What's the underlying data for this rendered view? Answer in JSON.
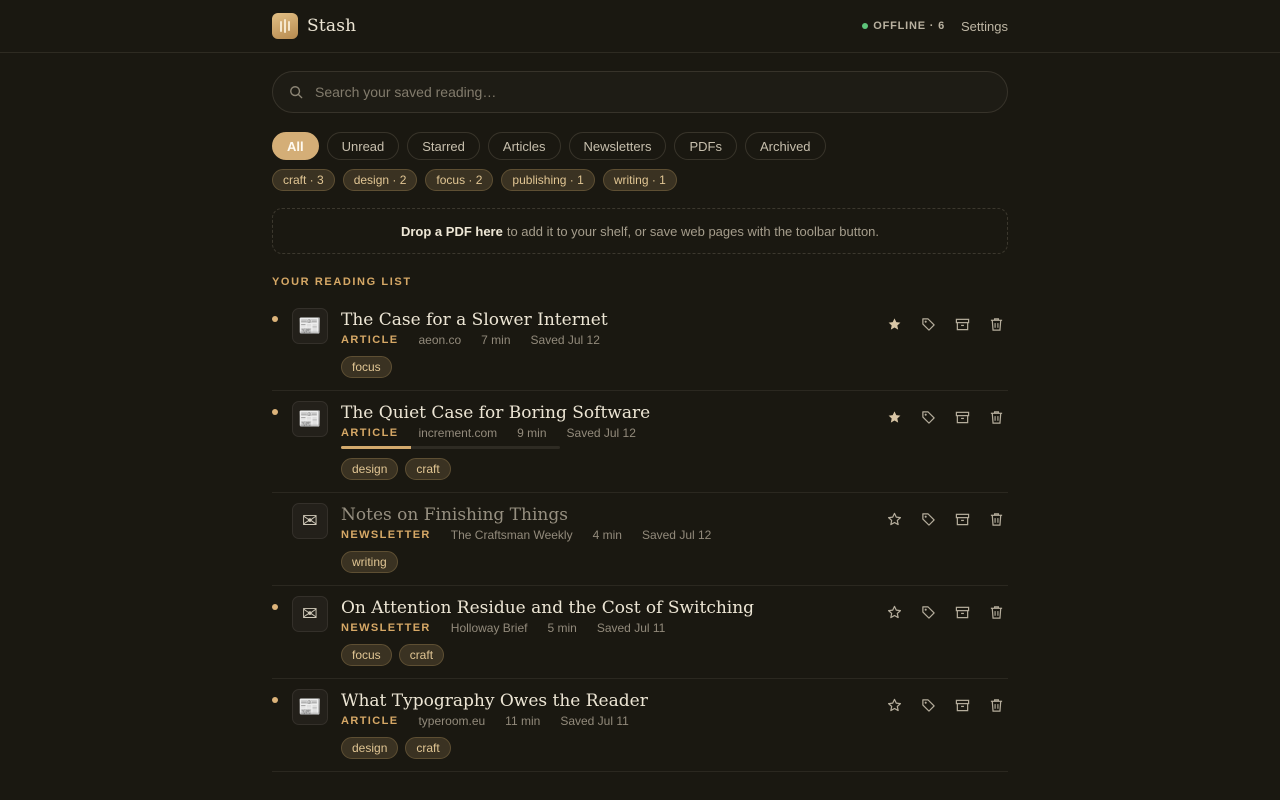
{
  "app": {
    "name": "Stash"
  },
  "header": {
    "status": "OFFLINE · 6",
    "settings_label": "Settings"
  },
  "search": {
    "placeholder": "Search your saved reading…"
  },
  "filters": [
    "All",
    "Unread",
    "Starred",
    "Articles",
    "Newsletters",
    "PDFs",
    "Archived"
  ],
  "active_filter": "All",
  "tags": [
    "craft · 3",
    "design · 2",
    "focus · 2",
    "publishing · 1",
    "writing · 1"
  ],
  "dropzone": {
    "strong": "Drop a PDF here",
    "text": "to add it to your shelf, or save web pages with the toolbar button."
  },
  "section_title": "YOUR READING LIST",
  "colors": {
    "accent": "#d4ae77",
    "background": "#1a1811",
    "online": "#5dc47a"
  },
  "items": [
    {
      "title": "The Case for a Slower Internet",
      "kind": "ARTICLE",
      "source": "aeon.co",
      "duration": "7 min",
      "saved": "Saved Jul 12",
      "tags": [
        "focus"
      ],
      "unread": true,
      "starred": true,
      "icon": "newspaper-icon"
    },
    {
      "title": "The Quiet Case for Boring Software",
      "kind": "ARTICLE",
      "source": "increment.com",
      "duration": "9 min",
      "saved": "Saved Jul 12",
      "tags": [
        "design",
        "craft"
      ],
      "unread": true,
      "starred": true,
      "progress": 0.32,
      "icon": "newspaper-icon"
    },
    {
      "title": "Notes on Finishing Things",
      "kind": "NEWSLETTER",
      "source": "The Craftsman Weekly",
      "duration": "4 min",
      "saved": "Saved Jul 12",
      "tags": [
        "writing"
      ],
      "unread": false,
      "starred": false,
      "icon": "envelope-icon"
    },
    {
      "title": "On Attention Residue and the Cost of Switching",
      "kind": "NEWSLETTER",
      "source": "Holloway Brief",
      "duration": "5 min",
      "saved": "Saved Jul 11",
      "tags": [
        "focus",
        "craft"
      ],
      "unread": true,
      "starred": false,
      "icon": "envelope-icon"
    },
    {
      "title": "What Typography Owes the Reader",
      "kind": "ARTICLE",
      "source": "typeroom.eu",
      "duration": "11 min",
      "saved": "Saved Jul 11",
      "tags": [
        "design",
        "craft"
      ],
      "unread": true,
      "starred": false,
      "icon": "newspaper-icon"
    }
  ]
}
